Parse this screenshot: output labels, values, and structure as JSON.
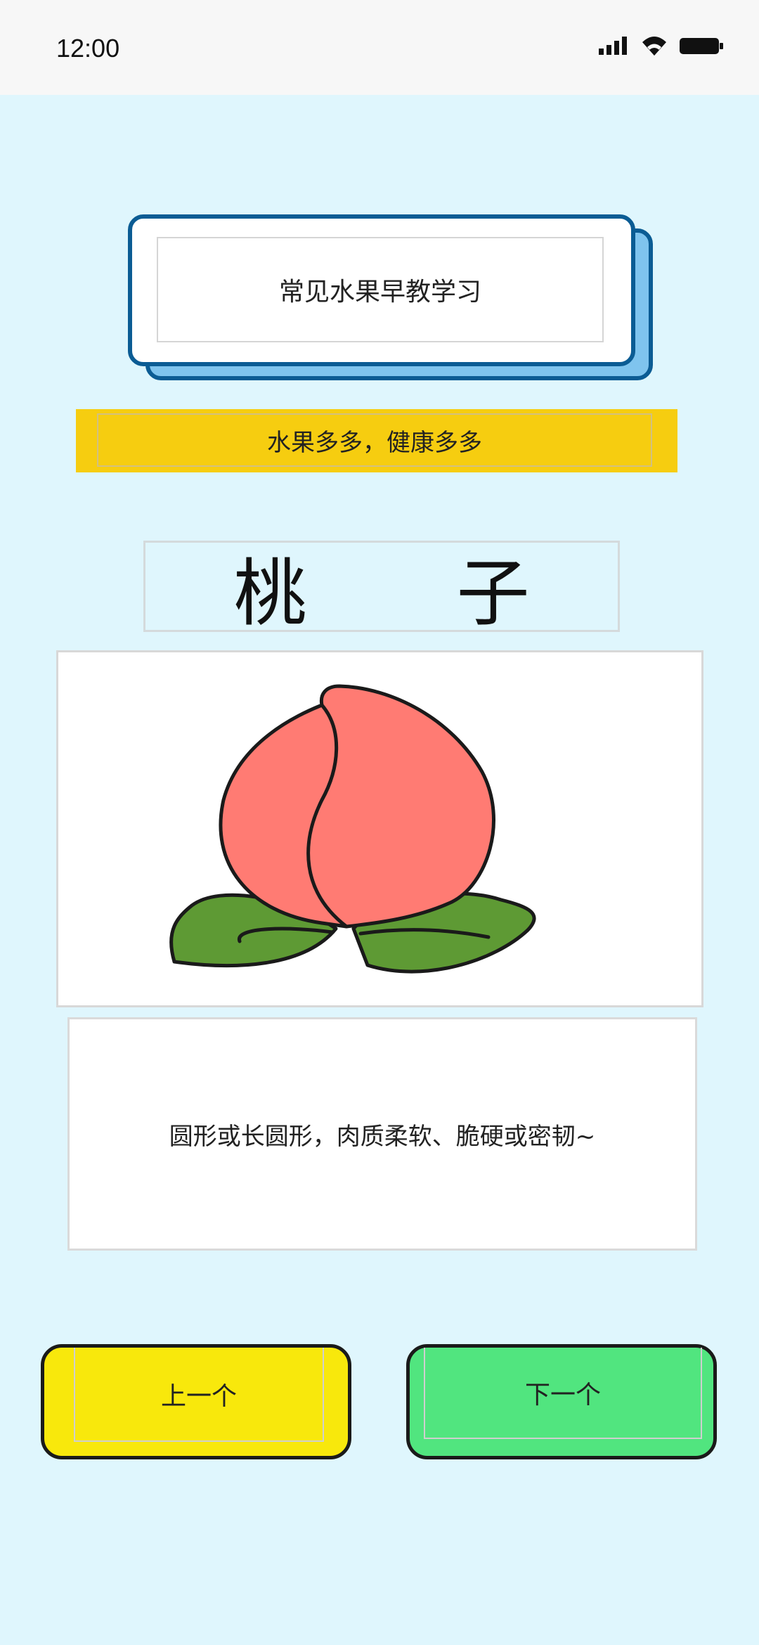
{
  "status_bar": {
    "time": "12:00",
    "icons": [
      "signal-icon",
      "wifi-icon",
      "battery-icon"
    ]
  },
  "header": {
    "title": "常见水果早教学习",
    "slogan": "水果多多，健康多多"
  },
  "fruit": {
    "name": "桃 子",
    "image_icon": "peach-illustration",
    "description": "圆形或长圆形，肉质柔软、脆硬或密韧~"
  },
  "navigation": {
    "prev_label": "上一个",
    "next_label": "下一个"
  },
  "colors": {
    "background": "#dff6fd",
    "title_border": "#0b5c94",
    "slogan_bg": "#f6cd10",
    "prev_button": "#f8e80c",
    "next_button": "#51e57f",
    "peach": "#ff7b73",
    "leaf": "#5e9a34"
  }
}
